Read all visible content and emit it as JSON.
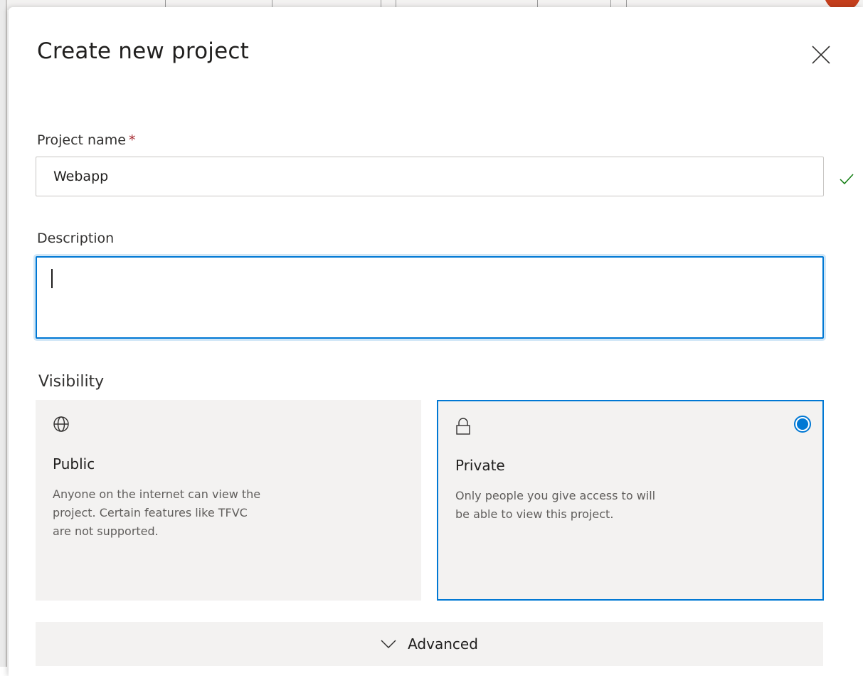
{
  "dialog": {
    "title": "Create new project",
    "close_icon": "close-icon"
  },
  "project_name": {
    "label": "Project name",
    "required_marker": "*",
    "value": "Webapp",
    "valid_icon": "checkmark-icon"
  },
  "description": {
    "label": "Description",
    "value": ""
  },
  "visibility": {
    "label": "Visibility",
    "options": [
      {
        "icon": "globe-icon",
        "title": "Public",
        "description": "Anyone on the internet can view the project. Certain features like TFVC are not supported.",
        "selected": false
      },
      {
        "icon": "lock-icon",
        "title": "Private",
        "description": "Only people you give access to will be able to view this project.",
        "selected": true
      }
    ]
  },
  "advanced": {
    "label": "Advanced",
    "icon": "chevron-down-icon"
  },
  "colors": {
    "accent": "#0078d4",
    "required": "#a4262c",
    "valid": "#107c10",
    "card_bg": "#f3f2f1"
  }
}
